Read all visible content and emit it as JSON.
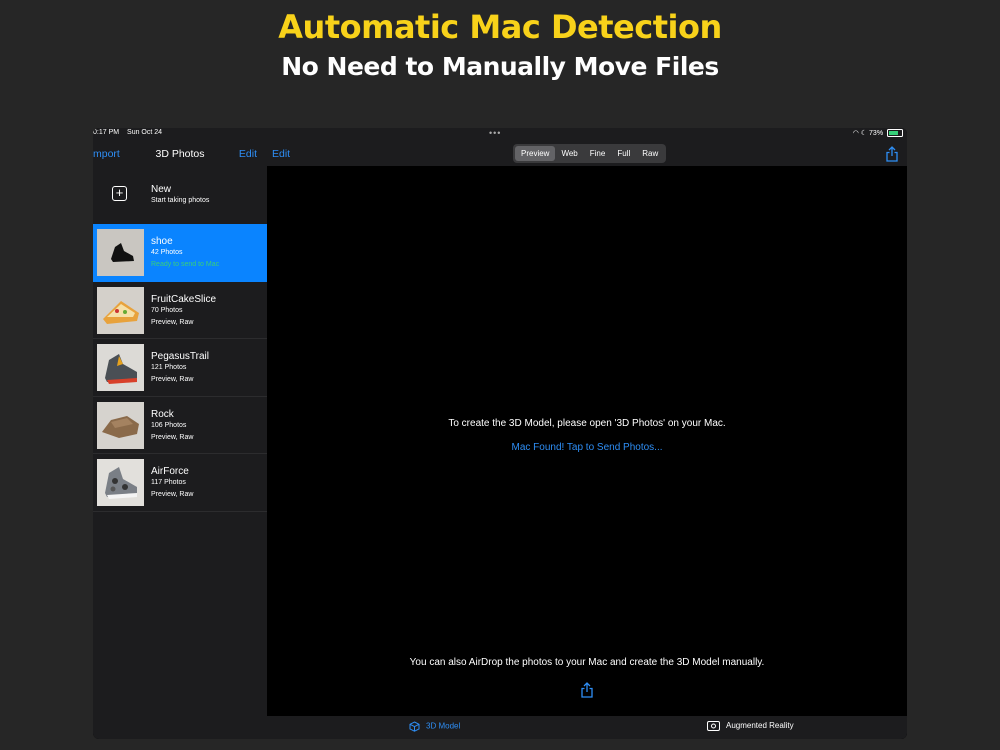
{
  "promo": {
    "headline": "Automatic Mac Detection",
    "subheadline": "No Need to Manually Move Files",
    "headline_color": "#f8d21a"
  },
  "status_bar": {
    "time": "0:17 PM",
    "date": "Sun Oct 24",
    "battery": "73%",
    "multitask_dots": "•••"
  },
  "sidebar": {
    "nav_left": "mport",
    "title": "3D Photos",
    "nav_right": "Edit",
    "new_item": {
      "title": "New",
      "subtitle": "Start taking photos",
      "icon": "plus-square-icon"
    },
    "items": [
      {
        "title": "shoe",
        "count": "42 Photos",
        "detail": "Ready to send to Mac",
        "selected": true
      },
      {
        "title": "FruitCakeSlice",
        "count": "70 Photos",
        "detail": "Preview, Raw",
        "selected": false
      },
      {
        "title": "PegasusTrail",
        "count": "121 Photos",
        "detail": "Preview, Raw",
        "selected": false
      },
      {
        "title": "Rock",
        "count": "106 Photos",
        "detail": "Preview, Raw",
        "selected": false
      },
      {
        "title": "AirForce",
        "count": "117 Photos",
        "detail": "Preview, Raw",
        "selected": false
      }
    ]
  },
  "detail": {
    "edit": "Edit",
    "segments": [
      "Preview",
      "Web",
      "Fine",
      "Full",
      "Raw"
    ],
    "selected_segment": "Preview",
    "message": "To create the 3D Model, please open '3D Photos' on your Mac.",
    "mac_found": "Mac Found! Tap to Send Photos...",
    "airdrop": "You can also AirDrop the photos to your Mac and create the 3D Model manually.",
    "share_icon": "share-icon"
  },
  "tabbar": {
    "tabs": [
      {
        "label": "3D Model",
        "icon": "cube-icon",
        "active": true
      },
      {
        "label": "Augmented Reality",
        "icon": "ar-camera-icon",
        "active": false
      }
    ]
  },
  "colors": {
    "accent": "#2e8ef5",
    "selection": "#0a84ff",
    "ready_text": "#38d07a"
  }
}
